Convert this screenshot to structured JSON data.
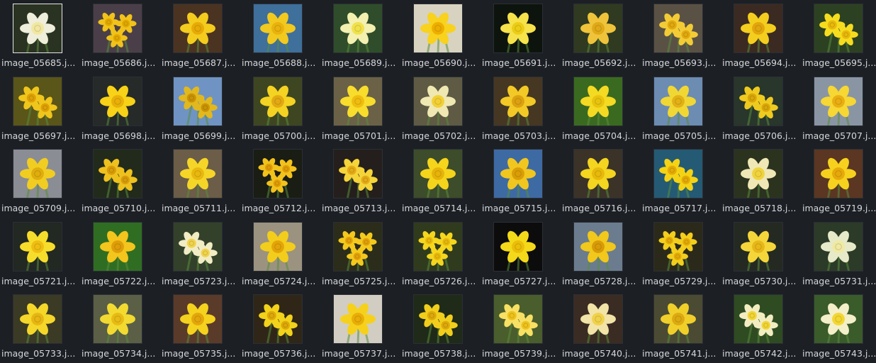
{
  "browser": {
    "selected_index": 0,
    "files": [
      {
        "name": "image_05685.j...",
        "bg": "#2a3322",
        "petal": "#eeeeda",
        "trumpet": "#f2e7a0",
        "flowers": 1
      },
      {
        "name": "image_05686.j...",
        "bg": "#4a3f48",
        "petal": "#f1c21a",
        "trumpet": "#e0a800",
        "flowers": 3
      },
      {
        "name": "image_05687.j...",
        "bg": "#4b3321",
        "petal": "#f4cc1e",
        "trumpet": "#e7aa06",
        "flowers": 1
      },
      {
        "name": "image_05688.j...",
        "bg": "#3f6f9b",
        "petal": "#f2c91e",
        "trumpet": "#e9b20d",
        "flowers": 1
      },
      {
        "name": "image_05689.j...",
        "bg": "#2f4d2a",
        "petal": "#f3f0b0",
        "trumpet": "#f0e14b",
        "flowers": 1
      },
      {
        "name": "image_05690.j...",
        "bg": "#d8d3c0",
        "petal": "#f8d21c",
        "trumpet": "#eeae00",
        "flowers": 1
      },
      {
        "name": "image_05691.j...",
        "bg": "#0d140d",
        "petal": "#f6e24a",
        "trumpet": "#eccd15",
        "flowers": 1
      },
      {
        "name": "image_05692.j...",
        "bg": "#2f3a21",
        "petal": "#efc43a",
        "trumpet": "#dfa918",
        "flowers": 1
      },
      {
        "name": "image_05693.j...",
        "bg": "#5a5145",
        "petal": "#f3cc35",
        "trumpet": "#e1a810",
        "flowers": 2
      },
      {
        "name": "image_05694.j...",
        "bg": "#3b2a21",
        "petal": "#f4ce1e",
        "trumpet": "#e2a60d",
        "flowers": 1
      },
      {
        "name": "image_05695.j...",
        "bg": "#2c4122",
        "petal": "#f6dc1e",
        "trumpet": "#e8b80d",
        "flowers": 2
      },
      {
        "name": "image_05697.j...",
        "bg": "#5a5519",
        "petal": "#f0c51c",
        "trumpet": "#dda006",
        "flowers": 2
      },
      {
        "name": "image_05698.j...",
        "bg": "#262a28",
        "petal": "#f7d217",
        "trumpet": "#e8b009",
        "flowers": 1
      },
      {
        "name": "image_05699.j...",
        "bg": "#6f94c3",
        "petal": "#e2b81c",
        "trumpet": "#c99306",
        "flowers": 2
      },
      {
        "name": "image_05700.j...",
        "bg": "#3e4621",
        "petal": "#f4d322",
        "trumpet": "#e2a912",
        "flowers": 1
      },
      {
        "name": "image_05701.j...",
        "bg": "#6b6147",
        "petal": "#f8dd2c",
        "trumpet": "#efbd0f",
        "flowers": 1
      },
      {
        "name": "image_05702.j...",
        "bg": "#5e5a43",
        "petal": "#efe8b2",
        "trumpet": "#f2cf34",
        "flowers": 1
      },
      {
        "name": "image_05703.j...",
        "bg": "#463723",
        "petal": "#f3c926",
        "trumpet": "#dca110",
        "flowers": 1
      },
      {
        "name": "image_05704.j...",
        "bg": "#3a6a20",
        "petal": "#f4da22",
        "trumpet": "#e8c30e",
        "flowers": 1
      },
      {
        "name": "image_05705.j...",
        "bg": "#6c8cb2",
        "petal": "#f1d734",
        "trumpet": "#e2b116",
        "flowers": 1
      },
      {
        "name": "image_05706.j...",
        "bg": "#28362b",
        "petal": "#efca1f",
        "trumpet": "#d9a60a",
        "flowers": 2
      },
      {
        "name": "image_05707.j...",
        "bg": "#8a95a4",
        "petal": "#f6d733",
        "trumpet": "#e9ae12",
        "flowers": 1
      },
      {
        "name": "image_05709.j...",
        "bg": "#8a8d93",
        "petal": "#f1cd22",
        "trumpet": "#dfad0d",
        "flowers": 1
      },
      {
        "name": "image_05710.j...",
        "bg": "#222a1c",
        "petal": "#eec11e",
        "trumpet": "#d89c0a",
        "flowers": 2
      },
      {
        "name": "image_05711.j...",
        "bg": "#6b5d47",
        "petal": "#f5d628",
        "trumpet": "#e8b80f",
        "flowers": 1
      },
      {
        "name": "image_05712.j...",
        "bg": "#1a1d14",
        "petal": "#f2c21c",
        "trumpet": "#de9c08",
        "flowers": 3
      },
      {
        "name": "image_05713.j...",
        "bg": "#241f1c",
        "petal": "#f5d43a",
        "trumpet": "#e4ab17",
        "flowers": 2
      },
      {
        "name": "image_05714.j...",
        "bg": "#3d4c2a",
        "petal": "#f5d41c",
        "trumpet": "#e6b30a",
        "flowers": 1
      },
      {
        "name": "image_05715.j...",
        "bg": "#3e6aa3",
        "petal": "#f1c61f",
        "trumpet": "#d99d07",
        "flowers": 1
      },
      {
        "name": "image_05716.j...",
        "bg": "#3b3328",
        "petal": "#f4d51f",
        "trumpet": "#e7b90b",
        "flowers": 1
      },
      {
        "name": "image_05717.j...",
        "bg": "#245a74",
        "petal": "#f5d314",
        "trumpet": "#e4ab07",
        "flowers": 2
      },
      {
        "name": "image_05718.j...",
        "bg": "#2b331f",
        "petal": "#efe7b5",
        "trumpet": "#f0d33c",
        "flowers": 1
      },
      {
        "name": "image_05719.j...",
        "bg": "#5b3622",
        "petal": "#f6d21e",
        "trumpet": "#e6a90a",
        "flowers": 1
      },
      {
        "name": "image_05721.j...",
        "bg": "#222822",
        "petal": "#f7dd2b",
        "trumpet": "#efbd12",
        "flowers": 1
      },
      {
        "name": "image_05722.j...",
        "bg": "#2f6e22",
        "petal": "#f3c51d",
        "trumpet": "#de9d09",
        "flowers": 1
      },
      {
        "name": "image_05723.j...",
        "bg": "#34412a",
        "petal": "#f1ecc3",
        "trumpet": "#f1d34b",
        "flowers": 2
      },
      {
        "name": "image_05724.j...",
        "bg": "#9b937f",
        "petal": "#f3cd1c",
        "trumpet": "#e3a409",
        "flowers": 1
      },
      {
        "name": "image_05725.j...",
        "bg": "#2b2d1a",
        "petal": "#f4c91e",
        "trumpet": "#e2a00a",
        "flowers": 3
      },
      {
        "name": "image_05726.j...",
        "bg": "#303b1e",
        "petal": "#f5d61e",
        "trumpet": "#e7b80c",
        "flowers": 3
      },
      {
        "name": "image_05727.j...",
        "bg": "#0c0c0c",
        "petal": "#f4d91a",
        "trumpet": "#ebbe09",
        "flowers": 1
      },
      {
        "name": "image_05728.j...",
        "bg": "#6b7c8e",
        "petal": "#f1c81b",
        "trumpet": "#d89a08",
        "flowers": 1
      },
      {
        "name": "image_05729.j...",
        "bg": "#2b2a1a",
        "petal": "#f3ce1c",
        "trumpet": "#e3aa08",
        "flowers": 3
      },
      {
        "name": "image_05730.j...",
        "bg": "#242a22",
        "petal": "#f5d63a",
        "trumpet": "#e7b719",
        "flowers": 1
      },
      {
        "name": "image_05731.j...",
        "bg": "#2c3a28",
        "petal": "#e7eac8",
        "trumpet": "#f0e9a2",
        "flowers": 1
      },
      {
        "name": "image_05733.j...",
        "bg": "#3b3a25",
        "petal": "#f5d72a",
        "trumpet": "#e7b612",
        "flowers": 1
      },
      {
        "name": "image_05734.j...",
        "bg": "#5a5f46",
        "petal": "#f3da31",
        "trumpet": "#e7bb14",
        "flowers": 1
      },
      {
        "name": "image_05735.j...",
        "bg": "#5a3b2a",
        "petal": "#f5d21e",
        "trumpet": "#e3a60b",
        "flowers": 1
      },
      {
        "name": "image_05736.j...",
        "bg": "#2f2618",
        "petal": "#f2d21a",
        "trumpet": "#dea80a",
        "flowers": 2
      },
      {
        "name": "image_05737.j...",
        "bg": "#d1cdc3",
        "petal": "#f6d11c",
        "trumpet": "#e9ad08",
        "flowers": 1
      },
      {
        "name": "image_05738.j...",
        "bg": "#1f2a18",
        "petal": "#f1ce1c",
        "trumpet": "#dda90b",
        "flowers": 2
      },
      {
        "name": "image_05739.j...",
        "bg": "#4a5d2c",
        "petal": "#f7e063",
        "trumpet": "#eec21c",
        "flowers": 2
      },
      {
        "name": "image_05740.j...",
        "bg": "#3a2c22",
        "petal": "#f2e3a6",
        "trumpet": "#f0d14a",
        "flowers": 1
      },
      {
        "name": "image_05741.j...",
        "bg": "#4b4b33",
        "petal": "#f1cf2a",
        "trumpet": "#dcaa10",
        "flowers": 1
      },
      {
        "name": "image_05742.j...",
        "bg": "#2f4b22",
        "petal": "#f2edc1",
        "trumpet": "#f2d534",
        "flowers": 2
      },
      {
        "name": "image_05743.j...",
        "bg": "#3a5b2a",
        "petal": "#f3efc8",
        "trumpet": "#f3d631",
        "flowers": 1
      }
    ]
  }
}
